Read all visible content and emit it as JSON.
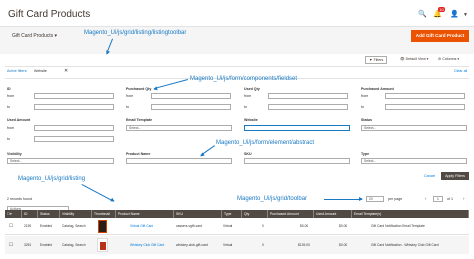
{
  "header": {
    "title": "Gift Card Products",
    "notifications_count": "10"
  },
  "toolbar": {
    "switcher_label": "Gift Card Products",
    "add_button": "Add Gift Card Product"
  },
  "annotations": {
    "listingtoolbar": "Magento_Ui/js/grid/listing/listingtoolbar",
    "fieldset": "Magento_Ui/js/form/components/fieldset",
    "element_abstract": "Magento_Ui/js/form/element/abstract",
    "listing": "Magento_Ui/js/grid/listing",
    "grid_toolbar": "Magento_Ui/js/grid/toolbar"
  },
  "active_filters": {
    "label": "Active filters:",
    "value": "Website",
    "clear_all": "Clear all"
  },
  "grid_controls": {
    "filters": "Filters",
    "default_view": "Default View",
    "columns": "Columns"
  },
  "filters": {
    "row1": [
      {
        "label": "ID",
        "from": "from",
        "to": "to"
      },
      {
        "label": "Purchased Qty",
        "from": "from",
        "to": "to"
      },
      {
        "label": "Used Qty",
        "from": "from",
        "to": "to"
      },
      {
        "label": "Purchased Amount",
        "from": "from",
        "to": "to"
      }
    ],
    "row2": {
      "used_amount": {
        "label": "Used Amount",
        "from": "from",
        "to": "to"
      },
      "email_template": {
        "label": "Email Template",
        "value": "Select..."
      },
      "website": {
        "label": "Website"
      },
      "status": {
        "label": "Status",
        "value": "Select..."
      }
    },
    "row3": {
      "visibility": {
        "label": "Visibility",
        "value": "Select..."
      },
      "product_name": {
        "label": "Product Name"
      },
      "sku": {
        "label": "SKU"
      },
      "type": {
        "label": "Type",
        "value": "Select..."
      }
    },
    "cancel": "Cancel",
    "apply": "Apply Filters"
  },
  "pager": {
    "records": "2 records found",
    "actions": "Actions",
    "per_page_value": "20",
    "per_page_label": "per page",
    "page": "1",
    "of": "of 1"
  },
  "table": {
    "headers": [
      "ID",
      "Status",
      "Visibility",
      "Thumbnail",
      "Product Name",
      "SKU",
      "Type",
      "Qty",
      "Purchased Amount",
      "Used Amount",
      "Email Template(s)"
    ],
    "rows": [
      {
        "id": "2159",
        "status": "Enabled",
        "visibility": "Catalog, Search",
        "name": "Virtual Gift Card",
        "sku": "vassers-vgift-card",
        "type": "Virtual",
        "qty": "0",
        "purchased": "$0.00",
        "used": "$0.00",
        "template": "Gift Card Notification Email Template"
      },
      {
        "id": "3251",
        "status": "Enabled",
        "visibility": "Catalog, Search",
        "name": "Whiskey Club Gift Card",
        "sku": "whiskey-club-gift-card",
        "type": "Virtual",
        "qty": "0",
        "purchased": "$139.00",
        "used": "$0.00",
        "template": "Gift Card Notification - Whiskey Club Gift Card"
      }
    ]
  }
}
